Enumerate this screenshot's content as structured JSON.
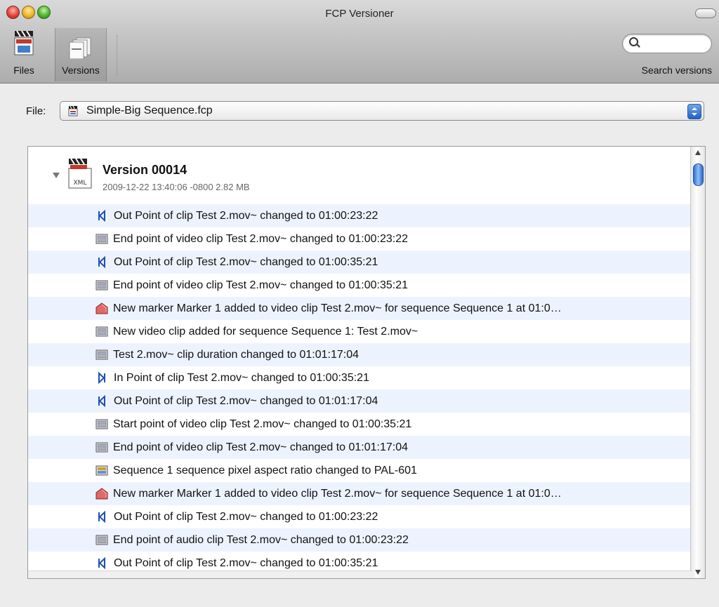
{
  "window": {
    "title": "FCP Versioner"
  },
  "toolbar": {
    "files_label": "Files",
    "versions_label": "Versions",
    "search_label": "Search versions",
    "search_placeholder": ""
  },
  "file_selector": {
    "label": "File:",
    "value": "Simple-Big Sequence.fcp"
  },
  "version": {
    "title": "Version 00014",
    "meta": "2009-12-22 13:40:06 -0800  2.82 MB",
    "icon_badge": "XML"
  },
  "changes": [
    {
      "icon": "out-point-icon",
      "text": "Out Point of clip Test 2.mov~ changed to 01:00:23:22"
    },
    {
      "icon": "video-clip-icon",
      "text": "End point of video clip Test 2.mov~ changed to 01:00:23:22"
    },
    {
      "icon": "out-point-icon",
      "text": "Out Point of clip Test 2.mov~ changed to 01:00:35:21"
    },
    {
      "icon": "video-clip-icon",
      "text": "End point of video clip Test 2.mov~ changed to 01:00:35:21"
    },
    {
      "icon": "marker-icon",
      "text": "New marker Marker 1 added to video clip Test 2.mov~ for sequence Sequence 1 at 01:0…"
    },
    {
      "icon": "video-clip-icon",
      "text": "New video clip added for sequence Sequence 1: Test 2.mov~"
    },
    {
      "icon": "video-clip-icon",
      "text": "Test 2.mov~ clip duration changed to 01:01:17:04"
    },
    {
      "icon": "in-point-icon",
      "text": "In Point of clip Test 2.mov~ changed to 01:00:35:21"
    },
    {
      "icon": "out-point-icon",
      "text": "Out Point of clip Test 2.mov~ changed to 01:01:17:04"
    },
    {
      "icon": "video-clip-icon",
      "text": "Start point of video clip Test 2.mov~ changed to 01:00:35:21"
    },
    {
      "icon": "video-clip-icon",
      "text": "End point of video clip Test 2.mov~ changed to 01:01:17:04"
    },
    {
      "icon": "sequence-icon",
      "text": "Sequence 1 sequence pixel aspect ratio changed to PAL-601"
    },
    {
      "icon": "marker-icon",
      "text": "New marker Marker 1 added to video clip Test 2.mov~ for sequence Sequence 1 at 01:0…"
    },
    {
      "icon": "out-point-icon",
      "text": "Out Point of clip Test 2.mov~ changed to 01:00:23:22"
    },
    {
      "icon": "audio-clip-icon",
      "text": "End point of audio clip Test 2.mov~ changed to 01:00:23:22"
    },
    {
      "icon": "out-point-icon",
      "text": "Out Point of clip Test 2.mov~ changed to 01:00:35:21"
    }
  ],
  "colors": {
    "row_alt": "#edf3fe",
    "accent": "#2f6fd0",
    "point_icon": "#1f4fb8",
    "marker": "#d9534f"
  }
}
